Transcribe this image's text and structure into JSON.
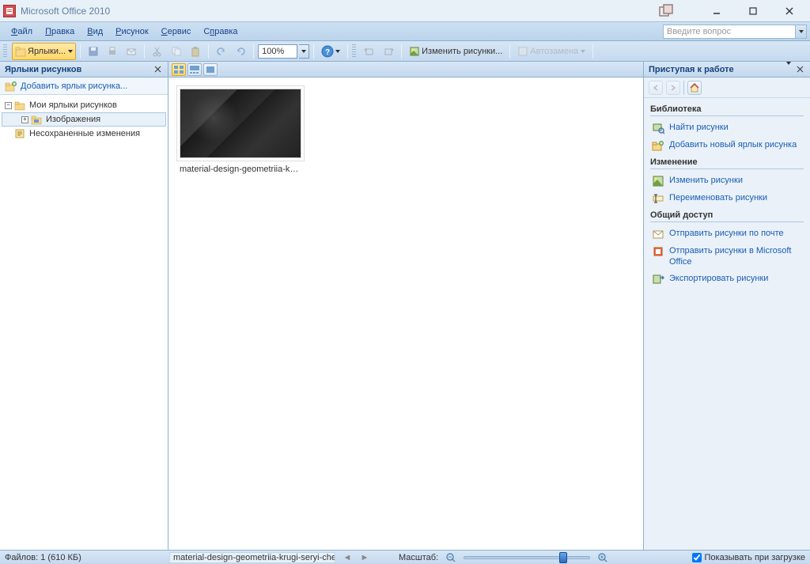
{
  "window": {
    "title": "Microsoft Office 2010"
  },
  "menu": {
    "items": [
      "Файл",
      "Правка",
      "Вид",
      "Рисунок",
      "Сервис",
      "Справка"
    ],
    "underlines": [
      0,
      0,
      0,
      0,
      0,
      1
    ],
    "search_placeholder": "Введите вопрос"
  },
  "toolbar": {
    "shortcuts_label": "Ярлыки...",
    "zoom_value": "100%",
    "edit_pictures_label": "Изменить рисунки...",
    "autocorrect_label": "Автозамена"
  },
  "left_pane": {
    "title": "Ярлыки рисунков",
    "add_link": "Добавить ярлык рисунка...",
    "nodes": [
      {
        "label": "Мои ярлыки рисунков",
        "expandable": true,
        "expanded": true,
        "level": 0
      },
      {
        "label": "Изображения",
        "expandable": true,
        "expanded": false,
        "level": 1,
        "selected": true
      },
      {
        "label": "Несохраненные изменения",
        "expandable": false,
        "level": 0
      }
    ]
  },
  "content": {
    "thumbnails": [
      {
        "caption": "material-design-geometriia-krugi-..."
      }
    ]
  },
  "right_pane": {
    "title": "Приступая к работе",
    "sections": [
      {
        "heading": "Библиотека",
        "links": [
          {
            "text": "Найти рисунки",
            "icon": "search-picture-icon"
          },
          {
            "text": "Добавить новый ярлык рисунка",
            "icon": "add-folder-icon"
          }
        ]
      },
      {
        "heading": "Изменение",
        "links": [
          {
            "text": "Изменить рисунки",
            "icon": "edit-picture-icon"
          },
          {
            "text": "Переименовать рисунки",
            "icon": "rename-icon"
          }
        ]
      },
      {
        "heading": "Общий доступ",
        "links": [
          {
            "text": "Отправить рисунки по почте",
            "icon": "mail-icon"
          },
          {
            "text": "Отправить рисунки в Microsoft Office",
            "icon": "office-icon"
          },
          {
            "text": "Экспортировать рисунки",
            "icon": "export-icon"
          }
        ]
      }
    ]
  },
  "statusbar": {
    "file_count": "Файлов: 1 (610 КБ)",
    "current_name": "material-design-geometriia-krugi-seryi-chernyi",
    "zoom_label": "Масштаб:",
    "show_on_load": "Показывать при загрузке"
  }
}
